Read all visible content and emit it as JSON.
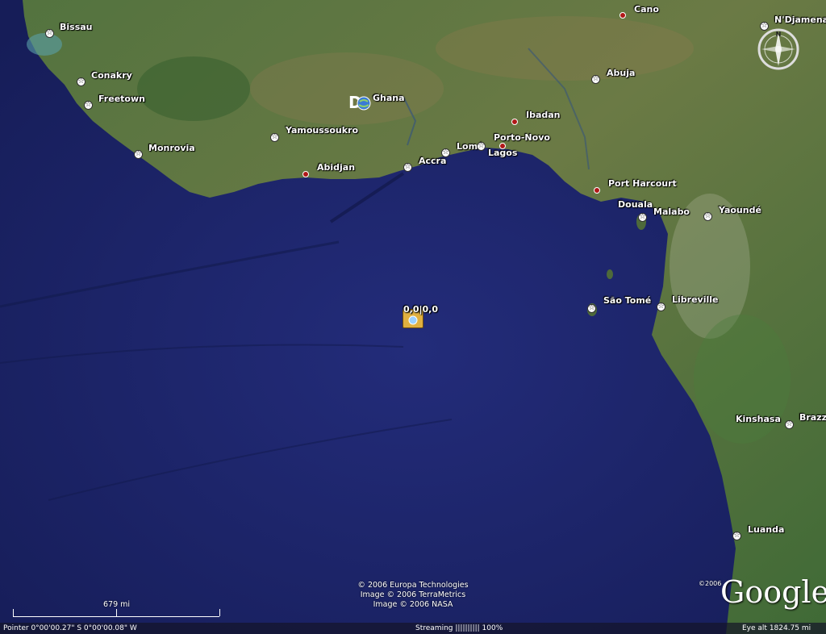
{
  "cities": [
    {
      "name": "Bissau",
      "marker": "capital"
    },
    {
      "name": "Conakry",
      "marker": "capital"
    },
    {
      "name": "Freetown",
      "marker": "capital"
    },
    {
      "name": "Monrovia",
      "marker": "capital"
    },
    {
      "name": "Yamoussoukro",
      "marker": "capital"
    },
    {
      "name": "Abidjan",
      "marker": "city"
    },
    {
      "name": "Ghana",
      "marker": "none"
    },
    {
      "name": "Accra",
      "marker": "capital"
    },
    {
      "name": "Lomé",
      "marker": "capital"
    },
    {
      "name": "Porto-Novo",
      "marker": "capital"
    },
    {
      "name": "Lagos",
      "marker": "city"
    },
    {
      "name": "Ibadan",
      "marker": "city"
    },
    {
      "name": "Abuja",
      "marker": "capital"
    },
    {
      "name": "Cano",
      "marker": "city"
    },
    {
      "name": "N'Djamena",
      "marker": "capital"
    },
    {
      "name": "Port Harcourt",
      "marker": "city"
    },
    {
      "name": "Douala",
      "marker": "city"
    },
    {
      "name": "Malabo",
      "marker": "capital"
    },
    {
      "name": "Yaoundé",
      "marker": "capital"
    },
    {
      "name": "São Tomé",
      "marker": "capital"
    },
    {
      "name": "Libreville",
      "marker": "capital"
    },
    {
      "name": "Kinshasa",
      "marker": "capital"
    },
    {
      "name": "Brazz",
      "marker": "none"
    },
    {
      "name": "Luanda",
      "marker": "capital"
    }
  ],
  "placemark": {
    "label": "0,0|0,0"
  },
  "copyright": {
    "line1": "© 2006 Europa Technologies",
    "line2": "Image © 2006 TerraMetrics",
    "line3": "Image © 2006 NASA"
  },
  "logo": {
    "text": "Google",
    "year": "©2006",
    "trademark": "™"
  },
  "scale": {
    "label": "679 mi"
  },
  "status": {
    "pointer": "Pointer  0°00'00.27\"   S     0°00'00.08\"   W",
    "streaming": "Streaming |||||||||| 100%",
    "eye_alt": "Eye alt  1824.75 mi"
  },
  "colors": {
    "ocean": "#1b2366",
    "land": "#4b6e3a",
    "city_pin": "#b01818"
  }
}
